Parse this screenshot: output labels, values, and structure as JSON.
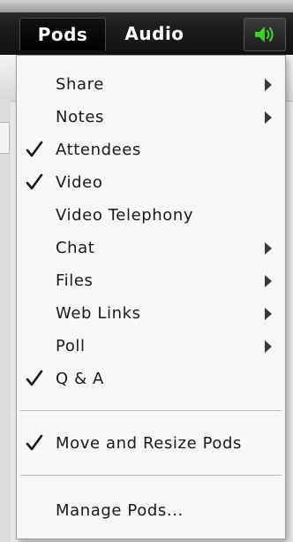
{
  "menubar": {
    "tabs": [
      {
        "label": "Pods"
      },
      {
        "label": "Audio"
      }
    ],
    "speaker_icon": "speaker-volume-icon",
    "speaker_color": "#3ccf2a"
  },
  "menu": {
    "items": [
      {
        "label": "Share",
        "checked": false,
        "submenu": true
      },
      {
        "label": "Notes",
        "checked": false,
        "submenu": true
      },
      {
        "label": "Attendees",
        "checked": true,
        "submenu": false
      },
      {
        "label": "Video",
        "checked": true,
        "submenu": false
      },
      {
        "label": "Video Telephony",
        "checked": false,
        "submenu": false
      },
      {
        "label": "Chat",
        "checked": false,
        "submenu": true
      },
      {
        "label": "Files",
        "checked": false,
        "submenu": true
      },
      {
        "label": "Web Links",
        "checked": false,
        "submenu": true
      },
      {
        "label": "Poll",
        "checked": false,
        "submenu": true
      },
      {
        "label": "Q & A",
        "checked": true,
        "submenu": false
      }
    ],
    "move_resize": {
      "label": "Move and Resize Pods",
      "checked": true
    },
    "manage": {
      "label": "Manage Pods..."
    }
  }
}
